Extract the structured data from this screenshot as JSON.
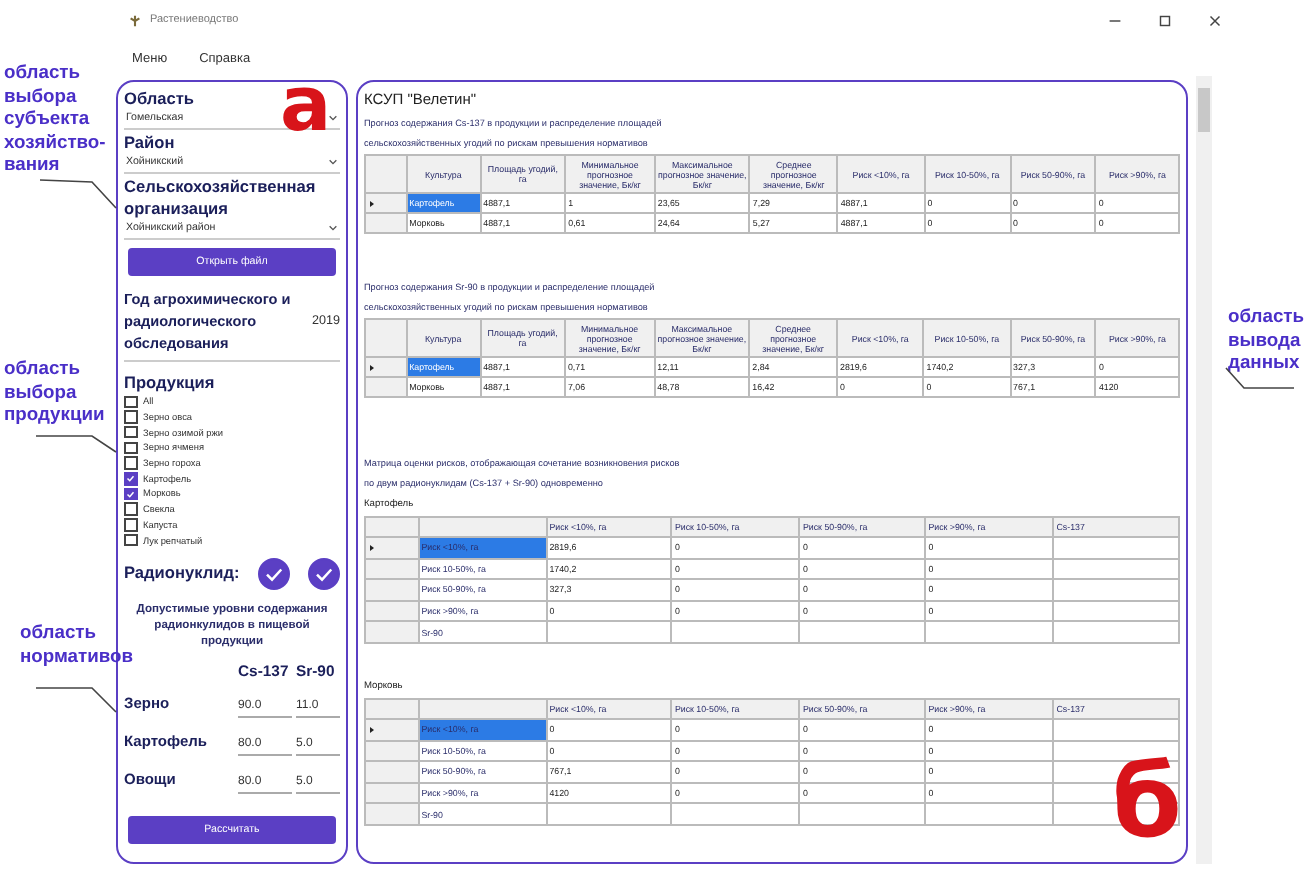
{
  "window": {
    "title": "Растениеводство"
  },
  "menu": [
    "Меню",
    "Справка"
  ],
  "selection": {
    "fields": [
      {
        "label": "Область",
        "value": "Гомельская"
      },
      {
        "label": "Район",
        "value": "Хойникский"
      },
      {
        "label": "Сельскохозяйственная организация",
        "value": "Хойникский район"
      }
    ],
    "open_button": "Открыть файл",
    "year": {
      "label": "Год агрохимического и радиологического обследования",
      "value": "2019"
    }
  },
  "products": {
    "title": "Продукция",
    "items": [
      {
        "label": "All",
        "checked": false
      },
      {
        "label": "Зерно овса",
        "checked": false
      },
      {
        "label": "Зерно озимой ржи",
        "checked": false
      },
      {
        "label": "Зерно ячменя",
        "checked": false
      },
      {
        "label": "Зерно гороха",
        "checked": false
      },
      {
        "label": "Картофель",
        "checked": true
      },
      {
        "label": "Морковь",
        "checked": true
      },
      {
        "label": "Свекла",
        "checked": false
      },
      {
        "label": "Капуста",
        "checked": false
      },
      {
        "label": "Лук репчатый",
        "checked": false
      }
    ]
  },
  "radionuclide": {
    "label": "Радионуклид:",
    "toggles": [
      {
        "checked": true
      },
      {
        "checked": true
      }
    ]
  },
  "norms": {
    "title": "Допустимые уровни содержания радионкулидов в пищевой продукции",
    "columns": [
      "Cs-137",
      "Sr-90"
    ],
    "rows": [
      {
        "name": "Зерно",
        "values": [
          "90.0",
          "11.0"
        ]
      },
      {
        "name": "Картофель",
        "values": [
          "80.0",
          "5.0"
        ]
      },
      {
        "name": "Овощи",
        "values": [
          "80.0",
          "5.0"
        ]
      }
    ]
  },
  "calculate_button": "Рассчитать",
  "output": {
    "organization": "КСУП \"Велетин\"",
    "tables": [
      {
        "title_lines": [
          "Прогноз содержания Cs-137 в продукции и распределение площадей",
          "сельскохозяйственных угодий по рискам превышения нормативов"
        ],
        "columns": [
          "Культура",
          "Площадь угодий, га",
          "Минимальное прогнозное значение, Бк/кг",
          "Максимальное прогнозное значение, Бк/кг",
          "Среднее прогнозное значение, Бк/кг",
          "Риск <10%, га",
          "Риск 10-50%, га",
          "Риск 50-90%, га",
          "Риск >90%, га"
        ],
        "rows": [
          {
            "current": true,
            "cells": [
              "Картофель",
              "4887,1",
              "1",
              "23,65",
              "7,29",
              "4887,1",
              "0",
              "0",
              "0"
            ]
          },
          {
            "current": false,
            "cells": [
              "Морковь",
              "4887,1",
              "0,61",
              "24,64",
              "5,27",
              "4887,1",
              "0",
              "0",
              "0"
            ]
          }
        ]
      },
      {
        "title_lines": [
          "Прогноз содержания Sr-90 в продукции и распределение площадей",
          "сельскохозяйственных угодий по рискам превышения нормативов"
        ],
        "columns": [
          "Культура",
          "Площадь угодий, га",
          "Минимальное прогнозное значение, Бк/кг",
          "Максимальное прогнозное значение, Бк/кг",
          "Среднее прогнозное значение, Бк/кг",
          "Риск <10%, га",
          "Риск 10-50%, га",
          "Риск 50-90%, га",
          "Риск >90%, га"
        ],
        "rows": [
          {
            "current": true,
            "cells": [
              "Картофель",
              "4887,1",
              "0,71",
              "12,11",
              "2,84",
              "2819,6",
              "1740,2",
              "327,3",
              "0"
            ]
          },
          {
            "current": false,
            "cells": [
              "Морковь",
              "4887,1",
              "7,06",
              "48,78",
              "16,42",
              "0",
              "0",
              "767,1",
              "4120"
            ]
          }
        ]
      }
    ],
    "matrix_caption_lines": [
      "Матрица оценки рисков, отображающая сочетание возникновения рисков",
      "по двум радионуклидам (Cs-137 + Sr-90) одновременно"
    ],
    "matrices": [
      {
        "crop": "Картофель",
        "columns": [
          "",
          "Риск <10%, га",
          "Риск 10-50%, га",
          "Риск 50-90%, га",
          "Риск >90%, га",
          "Cs-137"
        ],
        "rows": [
          {
            "current": true,
            "cells": [
              "Риск <10%, га",
              "2819,6",
              "0",
              "0",
              "0"
            ]
          },
          {
            "current": false,
            "cells": [
              "Риск 10-50%, га",
              "1740,2",
              "0",
              "0",
              "0"
            ]
          },
          {
            "current": false,
            "cells": [
              "Риск 50-90%, га",
              "327,3",
              "0",
              "0",
              "0"
            ]
          },
          {
            "current": false,
            "cells": [
              "Риск >90%, га",
              "0",
              "0",
              "0",
              "0"
            ]
          },
          {
            "current": false,
            "cells": [
              "Sr-90"
            ]
          }
        ]
      },
      {
        "crop": "Морковь",
        "columns": [
          "",
          "Риск <10%, га",
          "Риск 10-50%, га",
          "Риск 50-90%, га",
          "Риск >90%, га",
          "Cs-137"
        ],
        "rows": [
          {
            "current": true,
            "cells": [
              "Риск <10%, га",
              "0",
              "0",
              "0",
              "0"
            ]
          },
          {
            "current": false,
            "cells": [
              "Риск 10-50%, га",
              "0",
              "0",
              "0",
              "0"
            ]
          },
          {
            "current": false,
            "cells": [
              "Риск 50-90%, га",
              "767,1",
              "0",
              "0",
              "0"
            ]
          },
          {
            "current": false,
            "cells": [
              "Риск >90%, га",
              "4120",
              "0",
              "0",
              "0"
            ]
          },
          {
            "current": false,
            "cells": [
              "Sr-90"
            ]
          }
        ]
      }
    ]
  },
  "annotations": {
    "left": [
      "область выбора субъекта хозяйство-вания",
      "область выбора продукции",
      "область нормативов"
    ],
    "right": "область вывода данных",
    "markers": [
      "а",
      "б"
    ]
  }
}
